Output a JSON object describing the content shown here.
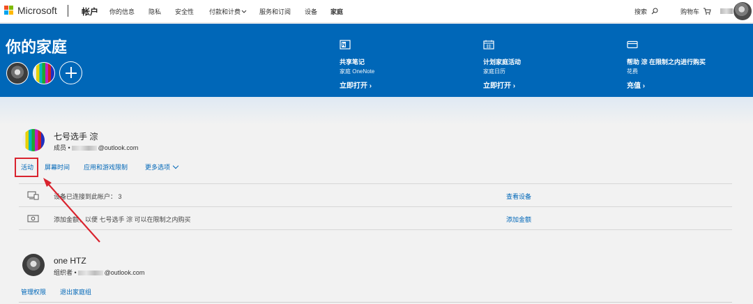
{
  "topnav": {
    "brand": "Microsoft",
    "account": "帐户",
    "items": [
      "你的信息",
      "隐私",
      "安全性",
      "付款和计费",
      "服务和订阅",
      "设备",
      "家庭"
    ],
    "search_label": "搜索",
    "cart_label": "购物车"
  },
  "hero": {
    "title": "你的家庭",
    "features": [
      {
        "icon": "onenote-icon",
        "title": "共享笔记",
        "subtitle": "家庭 OneNote",
        "link": "立即打开 ›"
      },
      {
        "icon": "calendar-icon",
        "title": "计划家庭活动",
        "subtitle": "家庭日历",
        "link": "立即打开 ›"
      },
      {
        "icon": "card-icon",
        "title": "帮助 淙 在限制之内进行购买",
        "subtitle": "花费",
        "link": "充值 ›"
      }
    ]
  },
  "members": [
    {
      "name": "七号选手 淙",
      "role": "成员 •",
      "email_suffix": "@outlook.com",
      "actions": [
        "活动",
        "屏幕时间",
        "应用和游戏限制",
        "更多选项"
      ],
      "rows": [
        {
          "icon": "devices-icon",
          "text": "设备已连接到此帐户： 3",
          "link": "查看设备"
        },
        {
          "icon": "money-icon",
          "text": "添加金额，以便 七号选手 淙 可以在限制之内购买",
          "link": "添加金额"
        }
      ]
    },
    {
      "name": "one HTZ",
      "role": "组织者 •",
      "email_suffix": "@outlook.com",
      "actions": [
        "管理权限",
        "退出家庭组"
      ]
    }
  ],
  "colors": {
    "accent": "#0067b8",
    "highlight": "#d9232e"
  }
}
